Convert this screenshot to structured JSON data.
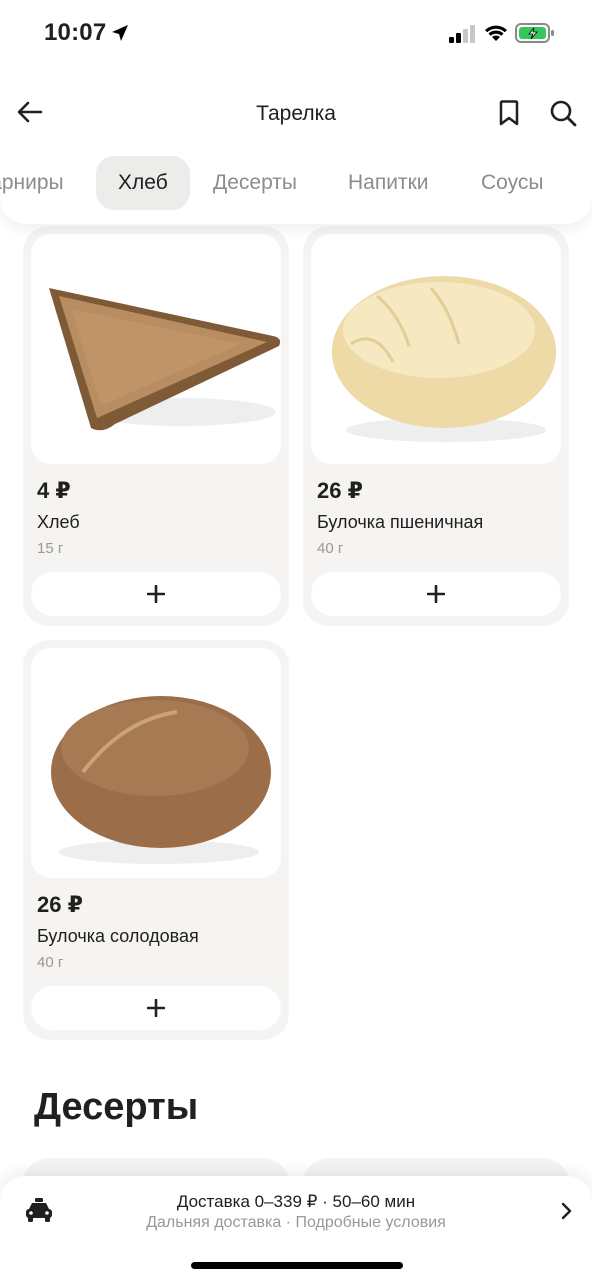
{
  "status_bar": {
    "time": "10:07"
  },
  "header": {
    "title": "Тарелка"
  },
  "tabs": [
    {
      "label": "Гарниры",
      "active": false
    },
    {
      "label": "Хлеб",
      "active": true
    },
    {
      "label": "Десерты",
      "active": false
    },
    {
      "label": "Напитки",
      "active": false
    },
    {
      "label": "Соусы",
      "active": false
    }
  ],
  "products": [
    {
      "price": "4 ₽",
      "name": "Хлеб",
      "weight": "15 г",
      "add_label": "+",
      "image": "rye-bread-slice"
    },
    {
      "price": "26 ₽",
      "name": "Булочка пшеничная",
      "weight": "40 г",
      "add_label": "+",
      "image": "wheat-bun"
    },
    {
      "price": "26 ₽",
      "name": "Булочка солодовая",
      "weight": "40 г",
      "add_label": "+",
      "image": "malt-bun"
    }
  ],
  "next_section": {
    "title": "Десерты"
  },
  "delivery": {
    "line1": "Доставка 0–339 ₽ · 50–60 мин",
    "line2": "Дальняя доставка · Подробные условия"
  },
  "colors": {
    "accent_charging": "#34c759",
    "card_bg": "#f5f4f2",
    "text_primary": "#21201f",
    "text_secondary": "#9a9896"
  }
}
